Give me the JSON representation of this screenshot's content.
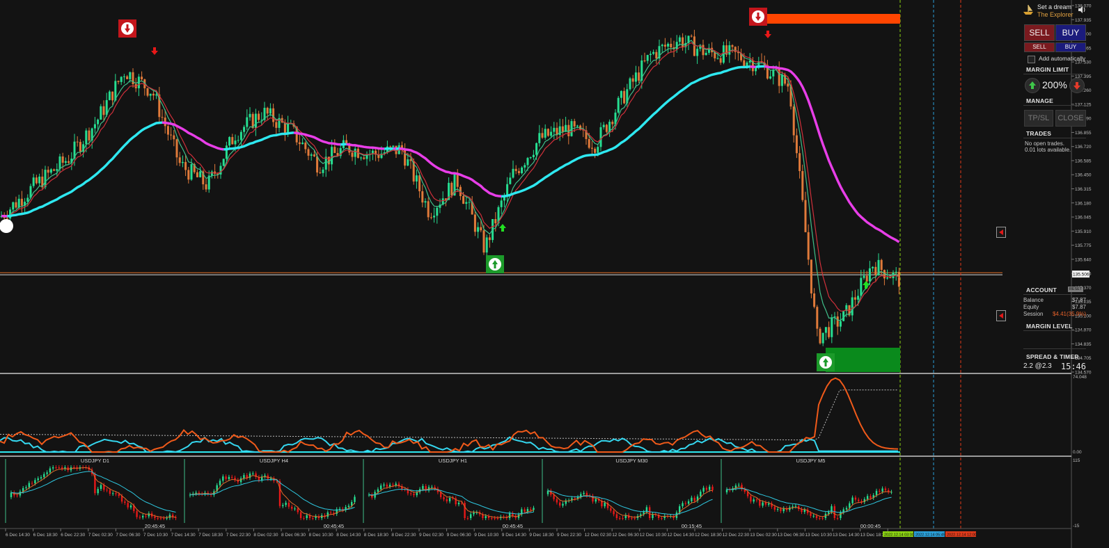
{
  "window": {
    "symbol": "USDJPY"
  },
  "theme": {
    "bg": "#131313",
    "bull": "#26de91",
    "bear": "#e07a3a",
    "ma_cyan": "#2ee8f0",
    "ma_magenta": "#e83ee8",
    "sell_zone": "#ff4500",
    "buy_zone": "#0a8a1c"
  },
  "panel": {
    "brand_line1": "Set a dream",
    "brand_line2": "The Explorer",
    "brand_icon": "ship-icon",
    "speaker_icon": "speaker-icon",
    "sell_label": "SELL",
    "buy_label": "BUY",
    "sell_small": "SELL",
    "buy_small": "BUY",
    "add_auto_label": "Add automatically",
    "margin_limit_title": "MARGIN LIMIT",
    "margin_limit_value": "200%",
    "manage_title": "MANAGE",
    "tp_sl_label": "TP/SL",
    "close_label": "CLOSE",
    "trades_title": "TRADES",
    "trades_msg1": "No open trades.",
    "trades_msg2": "0.01 lots available.",
    "account_title": "ACCOUNT",
    "reset_label": "RESET",
    "balance_label": "Balance",
    "balance_value": "$7.87",
    "equity_label": "Equity",
    "equity_value": "$7.87",
    "session_label": "Session",
    "session_value": "$4.41(35.9%)",
    "margin_level_title": "MARGIN LEVEL",
    "spread_title": "SPREAD & TIMER",
    "spread_value": "2.2 @2.3",
    "timer_value": "15:46"
  },
  "price_axis": [
    "138.070",
    "137.935",
    "137.800",
    "137.665",
    "137.530",
    "137.395",
    "137.260",
    "137.125",
    "136.990",
    "136.855",
    "136.720",
    "136.585",
    "136.450",
    "136.315",
    "136.180",
    "136.045",
    "135.910",
    "135.775",
    "135.640",
    "135.506",
    "135.370",
    "135.235",
    "135.100",
    "134.970",
    "134.835",
    "134.705",
    "134.570"
  ],
  "current_price": "135.506",
  "oscillator_axis": {
    "top": "74.048",
    "bottom": "0.00"
  },
  "mtf_axis": {
    "top": "115",
    "bottom": "-15"
  },
  "mtf_panels": [
    {
      "title": "USDJPY D1",
      "timer": "20:45:45"
    },
    {
      "title": "USDJPY H4",
      "timer": "00:45:45"
    },
    {
      "title": "USDJPY H1",
      "timer": "00:45:45"
    },
    {
      "title": "USDJPY M30",
      "timer": "00:15:45"
    },
    {
      "title": "USDJPY M5",
      "timer": "00:00:45"
    }
  ],
  "time_axis": [
    "6 Dec 14:30",
    "6 Dec 18:30",
    "6 Dec 22:30",
    "7 Dec 02:30",
    "7 Dec 06:30",
    "7 Dec 10:30",
    "7 Dec 14:30",
    "7 Dec 18:30",
    "7 Dec 22:30",
    "8 Dec 02:30",
    "8 Dec 06:30",
    "8 Dec 10:30",
    "8 Dec 14:30",
    "8 Dec 18:30",
    "8 Dec 22:30",
    "9 Dec 02:30",
    "9 Dec 06:30",
    "9 Dec 10:30",
    "9 Dec 14:30",
    "9 Dec 18:30",
    "9 Dec 22:30",
    "12 Dec 02:30",
    "12 Dec 06:30",
    "12 Dec 10:30",
    "12 Dec 14:30",
    "12 Dec 18:30",
    "12 Dec 22:30",
    "13 Dec 02:30",
    "13 Dec 06:30",
    "13 Dec 10:30",
    "13 Dec 14:30",
    "13 Dec 18:30",
    "13 Dec"
  ],
  "time_badges": [
    {
      "text": "2022.12.14 03:00",
      "color": "#8bd312"
    },
    {
      "text": "2022.12.14 05:45",
      "color": "#2a9fd8"
    },
    {
      "text": "2022.12.14 12:00",
      "color": "#e03a1a"
    }
  ],
  "chart_data": {
    "type": "candlestick",
    "symbol": "USDJPY",
    "ylim": [
      134.57,
      138.07
    ],
    "current_price": 135.506,
    "close_path": [
      {
        "x": 0,
        "y": 136.05
      },
      {
        "x": 10,
        "y": 136.35
      },
      {
        "x": 20,
        "y": 136.62
      },
      {
        "x": 28,
        "y": 136.97
      },
      {
        "x": 36,
        "y": 137.45
      },
      {
        "x": 44,
        "y": 137.25
      },
      {
        "x": 52,
        "y": 136.55
      },
      {
        "x": 60,
        "y": 136.35
      },
      {
        "x": 68,
        "y": 136.85
      },
      {
        "x": 76,
        "y": 137.05
      },
      {
        "x": 84,
        "y": 136.88
      },
      {
        "x": 92,
        "y": 136.55
      },
      {
        "x": 100,
        "y": 136.72
      },
      {
        "x": 108,
        "y": 136.65
      },
      {
        "x": 116,
        "y": 136.7
      },
      {
        "x": 124,
        "y": 136.1
      },
      {
        "x": 132,
        "y": 136.4
      },
      {
        "x": 140,
        "y": 135.75
      },
      {
        "x": 148,
        "y": 136.45
      },
      {
        "x": 156,
        "y": 136.8
      },
      {
        "x": 164,
        "y": 136.9
      },
      {
        "x": 172,
        "y": 136.75
      },
      {
        "x": 180,
        "y": 137.2
      },
      {
        "x": 188,
        "y": 137.6
      },
      {
        "x": 196,
        "y": 137.75
      },
      {
        "x": 204,
        "y": 137.62
      },
      {
        "x": 212,
        "y": 137.6
      },
      {
        "x": 220,
        "y": 137.5
      },
      {
        "x": 228,
        "y": 137.3
      },
      {
        "x": 236,
        "y": 134.9
      },
      {
        "x": 244,
        "y": 135.1
      },
      {
        "x": 252,
        "y": 135.6
      },
      {
        "x": 260,
        "y": 135.45
      }
    ],
    "signals": [
      {
        "type": "sell",
        "label": "down-arrow-marker"
      },
      {
        "type": "buy",
        "label": "up-arrow-marker"
      },
      {
        "type": "sell",
        "label": "down-arrow-marker"
      },
      {
        "type": "buy",
        "label": "up-arrow-marker"
      }
    ]
  }
}
